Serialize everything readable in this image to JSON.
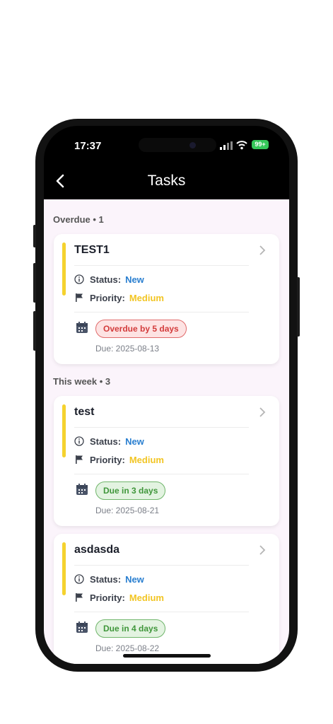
{
  "status_bar": {
    "time": "17:37",
    "battery": "99+"
  },
  "nav": {
    "title": "Tasks"
  },
  "sections": {
    "overdue": {
      "title": "Overdue • 1"
    },
    "this_week": {
      "title": "This week • 3"
    }
  },
  "labels": {
    "status": "Status:",
    "priority": "Priority:"
  },
  "tasks": [
    {
      "title": "TEST1",
      "status": "New",
      "priority": "Medium",
      "badge": "Overdue by 5 days",
      "due": "Due: 2025-08-13"
    },
    {
      "title": "test",
      "status": "New",
      "priority": "Medium",
      "badge": "Due in 3 days",
      "due": "Due: 2025-08-21"
    },
    {
      "title": "asdasda",
      "status": "New",
      "priority": "Medium",
      "badge": "Due in 4 days",
      "due": "Due: 2025-08-22"
    }
  ],
  "colors": {
    "accent_bar": "#f5d22e",
    "status_new": "#2a7fd0",
    "priority_medium": "#f2c523",
    "overdue": "#d33b3b",
    "due_soon": "#3f963a",
    "background": "#fbf4fb"
  },
  "icons": [
    "back-chevron-icon",
    "info-icon",
    "flag-icon",
    "calendar-icon",
    "chevron-right-icon",
    "signal-icon",
    "wifi-icon",
    "battery-icon"
  ]
}
